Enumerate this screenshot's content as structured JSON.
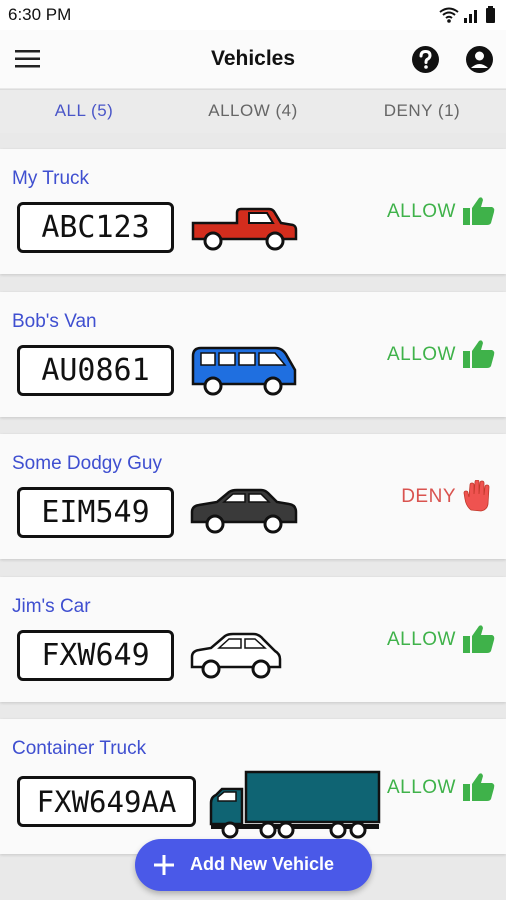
{
  "status_bar": {
    "time": "6:30 PM"
  },
  "header": {
    "title": "Vehicles"
  },
  "tabs": [
    {
      "label": "ALL (5)",
      "active": true
    },
    {
      "label": "ALLOW (4)",
      "active": false
    },
    {
      "label": "DENY (1)",
      "active": false
    }
  ],
  "vehicles": [
    {
      "name": "My Truck",
      "plate": "ABC123",
      "type": "pickup-truck",
      "color": "#d32d1d",
      "status": "ALLOW"
    },
    {
      "name": "Bob's Van",
      "plate": "AU0861",
      "type": "van",
      "color": "#1f6fe0",
      "status": "ALLOW"
    },
    {
      "name": "Some Dodgy Guy",
      "plate": "EIM549",
      "type": "sedan",
      "color": "#3a3a3a",
      "status": "DENY"
    },
    {
      "name": "Jim's Car",
      "plate": "FXW649",
      "type": "hatchback",
      "color": "#ffffff",
      "status": "ALLOW"
    },
    {
      "name": "Container Truck",
      "plate": "FXW649AA",
      "type": "semi-truck",
      "color": "#0f6473",
      "status": "ALLOW"
    }
  ],
  "fab": {
    "label": "Add New Vehicle"
  },
  "colors": {
    "accent": "#4a59e8",
    "allow": "#3fb24a",
    "deny": "#d9534f",
    "name": "#3f4fd0"
  }
}
